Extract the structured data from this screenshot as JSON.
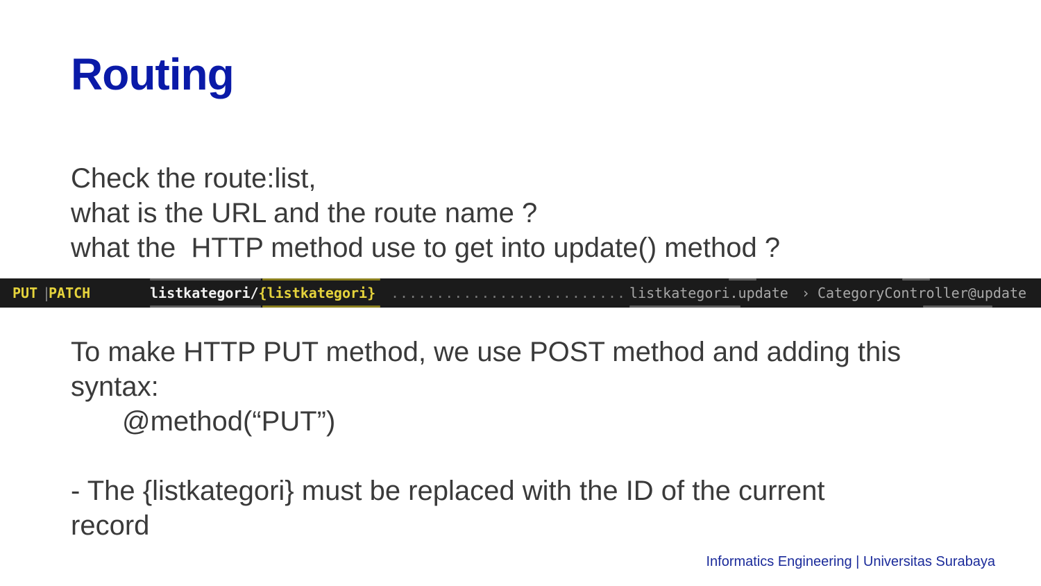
{
  "slide": {
    "title": "Routing",
    "intro_lines": [
      "Check the route:list,",
      "what is the URL and the route name ?",
      "what the  HTTP method use to get into update() method ?"
    ],
    "terminal": {
      "method_put": "PUT",
      "method_separator": "|",
      "method_patch": "PATCH",
      "uri_prefix": "listkategori/",
      "uri_param": "{listkategori}",
      "dots": "..........................",
      "route_name": "listkategori.update",
      "arrow": "›",
      "action": "CategoryController@update"
    },
    "put_lines": [
      "To make HTTP PUT method, we use POST method and adding this",
      "syntax:",
      "@method(“PUT”)"
    ],
    "note_lines": [
      "- The {listkategori} must be replaced with the ID of the current",
      "record"
    ],
    "footer": "Informatics Engineering | Universitas Surabaya"
  },
  "colors": {
    "title": "#0a1aa8",
    "body_text": "#3a3a3a",
    "terminal_bg": "#1b1b1b",
    "terminal_yellow": "#e5d33c",
    "footer": "#1a2a9a"
  }
}
